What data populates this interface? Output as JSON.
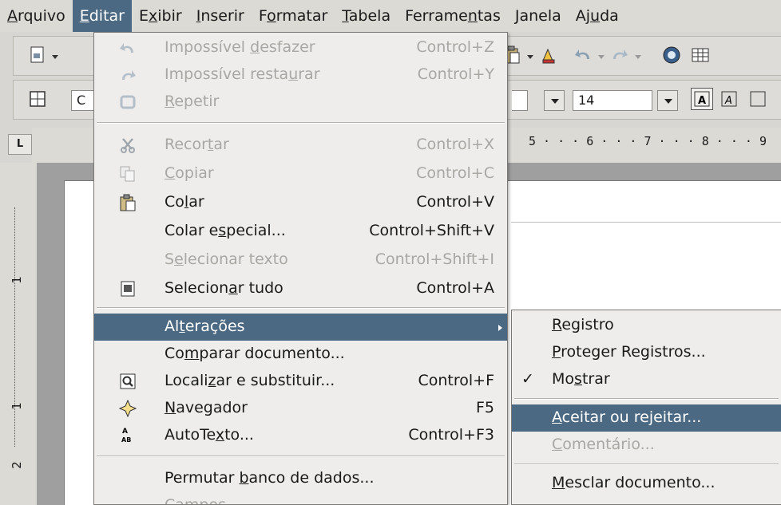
{
  "menubar": [
    {
      "pre": "",
      "u": "A",
      "post": "rquivo"
    },
    {
      "pre": "",
      "u": "E",
      "post": "ditar"
    },
    {
      "pre": "E",
      "u": "x",
      "post": "ibir"
    },
    {
      "pre": "",
      "u": "I",
      "post": "nserir"
    },
    {
      "pre": "F",
      "u": "o",
      "post": "rmatar"
    },
    {
      "pre": "",
      "u": "T",
      "post": "abela"
    },
    {
      "pre": "Ferrame",
      "u": "n",
      "post": "tas"
    },
    {
      "pre": "",
      "u": "J",
      "post": "anela"
    },
    {
      "pre": "Aj",
      "u": "u",
      "post": "da"
    }
  ],
  "toolbar2": {
    "font_name_fragment": "C",
    "font_size": "14"
  },
  "ruler": {
    "corner": "L",
    "numbers": "5 · · · 6 · · · 7 · · · 8 · · · 9",
    "vertical": [
      "1",
      "1",
      "2"
    ]
  },
  "edit_menu": [
    {
      "pre": "Impossível ",
      "u": "d",
      "post": "esfazer",
      "shortcut": "Control+Z",
      "icon": "undo-icon",
      "glyph": "↶",
      "disabled": true
    },
    {
      "pre": "Impossível resta",
      "u": "u",
      "post": "rar",
      "shortcut": "Control+Y",
      "icon": "redo-icon",
      "glyph": "↷",
      "disabled": true
    },
    {
      "pre": "",
      "u": "R",
      "post": "epetir",
      "shortcut": "",
      "icon": "repeat-icon",
      "glyph": "⟳",
      "disabled": true
    },
    {
      "pre": "Recor",
      "u": "t",
      "post": "ar",
      "shortcut": "Control+X",
      "icon": "cut-icon",
      "glyph": "✂",
      "disabled": true
    },
    {
      "pre": "",
      "u": "C",
      "post": "opiar",
      "shortcut": "Control+C",
      "icon": "copy-icon",
      "glyph": "⧉",
      "disabled": true
    },
    {
      "pre": "Co",
      "u": "l",
      "post": "ar",
      "shortcut": "Control+V",
      "icon": "paste-icon",
      "glyph": "📋",
      "disabled": false
    },
    {
      "pre": "Colar e",
      "u": "s",
      "post": "pecial...",
      "shortcut": "Control+Shift+V",
      "icon": "",
      "glyph": "",
      "disabled": false
    },
    {
      "pre": "S",
      "u": "e",
      "post": "lecionar texto",
      "shortcut": "Control+Shift+I",
      "icon": "",
      "glyph": "",
      "disabled": true
    },
    {
      "pre": "Selecion",
      "u": "a",
      "post": "r tudo",
      "shortcut": "Control+A",
      "icon": "select-all-icon",
      "glyph": "▣",
      "disabled": false
    },
    {
      "pre": "Al",
      "u": "t",
      "post": "erações",
      "shortcut": "",
      "icon": "",
      "glyph": "",
      "disabled": false
    },
    {
      "pre": "Co",
      "u": "m",
      "post": "parar documento...",
      "shortcut": "",
      "icon": "",
      "glyph": "",
      "disabled": false
    },
    {
      "pre": "Locali",
      "u": "z",
      "post": "ar e substituir...",
      "shortcut": "Control+F",
      "icon": "find-replace-icon",
      "glyph": "🔍",
      "disabled": false
    },
    {
      "pre": "",
      "u": "N",
      "post": "avegador",
      "shortcut": "F5",
      "icon": "navigator-icon",
      "glyph": "✧",
      "disabled": false
    },
    {
      "pre": "AutoTe",
      "u": "x",
      "post": "to...",
      "shortcut": "Control+F3",
      "icon": "autotext-icon",
      "glyph": "ª",
      "disabled": false
    },
    {
      "pre": "Permutar ",
      "u": "b",
      "post": "anco de dados...",
      "shortcut": "",
      "icon": "",
      "glyph": "",
      "disabled": false
    },
    {
      "pre": "Campos",
      "u": "",
      "post": "",
      "shortcut": "",
      "icon": "",
      "glyph": "",
      "disabled": true
    }
  ],
  "submenu": [
    {
      "pre": "",
      "u": "R",
      "post": "egistro",
      "check": "",
      "disabled": false
    },
    {
      "pre": "",
      "u": "P",
      "post": "roteger Registros...",
      "check": "",
      "disabled": false
    },
    {
      "pre": "Mo",
      "u": "s",
      "post": "trar",
      "check": "✓",
      "disabled": false
    },
    {
      "pre": "",
      "u": "A",
      "post": "ceitar ou rejeitar...",
      "check": "",
      "disabled": false
    },
    {
      "pre": "",
      "u": "C",
      "post": "omentário...",
      "check": "",
      "disabled": true
    },
    {
      "pre": "",
      "u": "M",
      "post": "esclar documento...",
      "check": "",
      "disabled": false
    }
  ],
  "colors": {
    "highlight": "#4b6983",
    "menu_bg": "#eeedeb",
    "disabled_text": "#a9a7a3"
  }
}
